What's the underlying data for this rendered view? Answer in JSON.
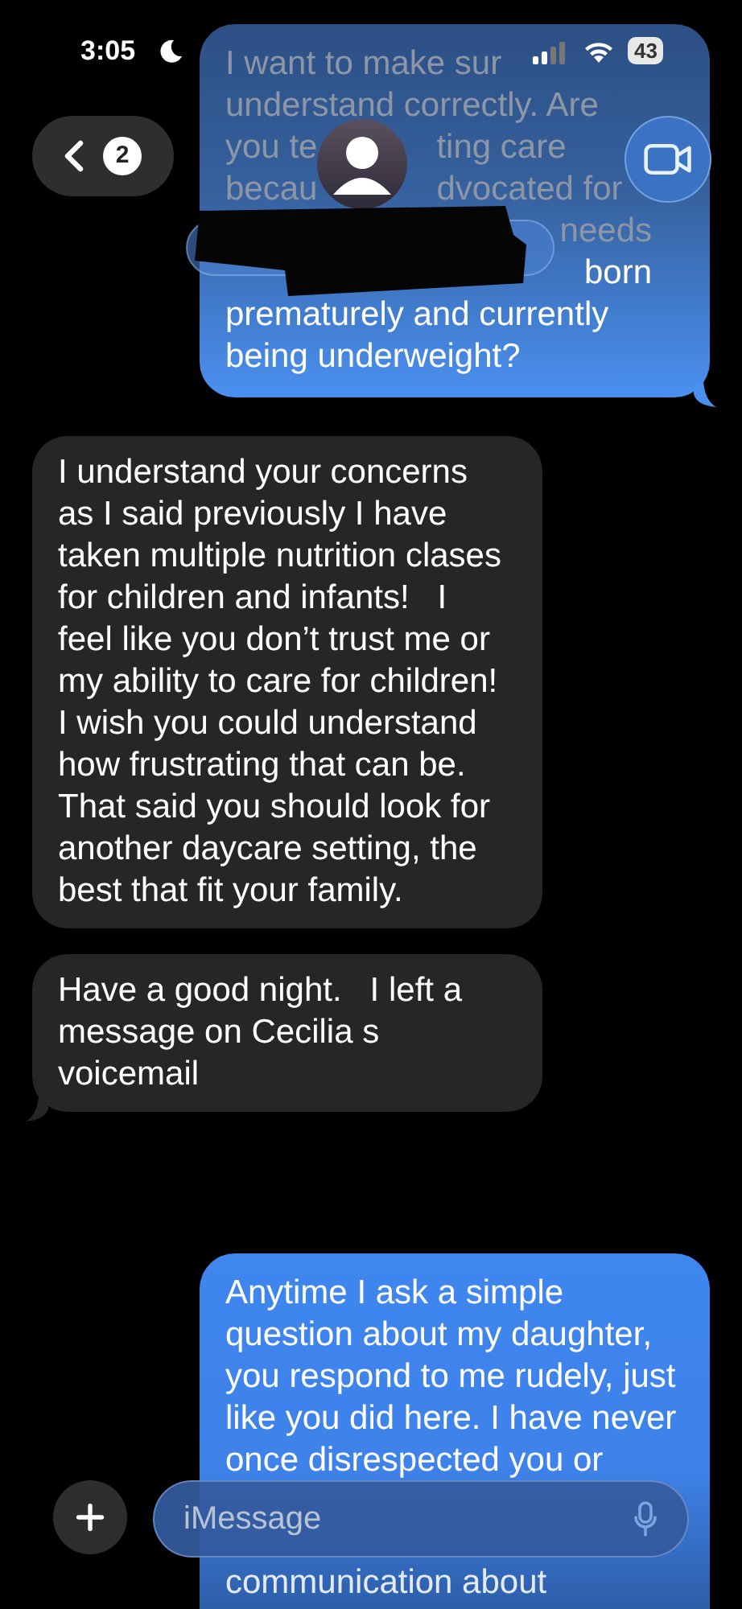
{
  "status_bar": {
    "time": "3:05",
    "battery": "43"
  },
  "header": {
    "back_count": "2"
  },
  "messages": [
    {
      "kind": "sent_fragmented",
      "lines": [
        {
          "covered_start": false,
          "dimmed": true,
          "fragments": [
            "I want to make sur"
          ]
        },
        {
          "covered_start": false,
          "dimmed": true,
          "fragments": [
            "understand correctly. Are"
          ]
        },
        {
          "covered_start": false,
          "dimmed": true,
          "fragments": [
            "you te",
            "ting care"
          ]
        },
        {
          "covered_start": false,
          "dimmed": true,
          "fragments": [
            "becau",
            "dvocated for"
          ]
        },
        {
          "covered_start": true,
          "dimmed": true,
          "fragments": [
            "needs"
          ]
        },
        {
          "covered_start": true,
          "dimmed": false,
          "fragments": [
            "born"
          ]
        },
        {
          "covered_start": false,
          "dimmed": false,
          "fragments": [
            "prematurely and currently"
          ]
        },
        {
          "covered_start": false,
          "dimmed": false,
          "fragments": [
            "being underweight?"
          ]
        }
      ]
    },
    {
      "kind": "received",
      "tail": false,
      "text": "I understand your concerns as I said previously I have taken multiple nutrition clases  for children and infants!   I feel like you don’t trust me or my ability to care for children! I wish you could understand how frustrating that can be. That said you should look for another daycare setting, the best that fit your family."
    },
    {
      "kind": "received",
      "tail": true,
      "text": "Have a good night.   I left a message on Cecilia s voicemail"
    },
    {
      "kind": "sent",
      "text": "Anytime I ask a simple question about my daughter, you respond to me rudely, just like you did here. I have never once disrespected you or",
      "text_after": "communication about"
    }
  ],
  "composer": {
    "placeholder": "iMessage"
  }
}
